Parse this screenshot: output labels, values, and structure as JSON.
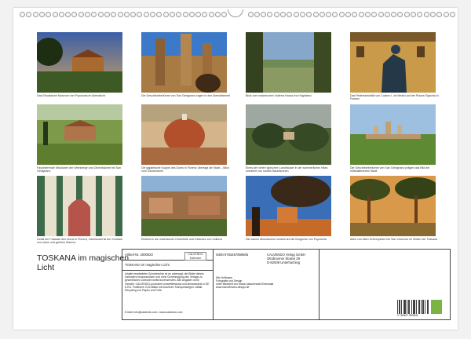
{
  "captions": [
    "Das Etruskische Museum von Populonia im Abendlicht",
    "Die Geschlechtertürme von San Gimignano ragen in den Abendhimmel",
    "Blick vom malerischen Volterra hinaus ins Hügelland",
    "Das Reiterstandbild von Cosimo I. de Medici auf der Piazza Signoria in Florenz",
    "Faszinierende Strukturen der Weinberge und Olivenbäume bei San Gimignano",
    "Die gigantische Kuppel des Doms in Florenz überragt die Stadt – Blick vom Glockenturm",
    "Eines der vielen typischen Landhäuser in der sommerlichen Hitze, umrahmt von runden Baumkronen",
    "Die Geschlechtertürme von San Gimignano prägen das Bild der mittelalterlichen Stadt",
    "Detail der Fassade des Doms in Florenz, interessant ist der Kontrast von rotem und grünem Marmor",
    "Einblick in die malerischen Hinterhöfe und Gärtchen von Volterra",
    "Die warme Abendsonne scheint auf die Burgruine von Populonia",
    "Allee von alten Schirmpinien bei San Vincenzo im Süden der Toskana"
  ],
  "title": "TOSKANA im magischen Licht",
  "imprint": {
    "artikel": "Artikel-Nr. 2000020",
    "logo": "CALVENDO Kalender",
    "title_line": "TOSKANA im magischen Licht",
    "isbn": "ISBN 9783457859605",
    "publisher": [
      "CALVENDO Verlag GmbH",
      "Ottobrunner Straße 39",
      "D-82008 Unterhaching"
    ],
    "author": [
      "Nils Hoffmann",
      "Fotografie und Design",
      "unter Mitarbeit von Maria Jakschewski Ebenwald",
      "www.nicnoffmann-design.de"
    ],
    "legal": "Inhalte bearbeiteter Schutzrechte ist es untersagt, die Bilder dieses Kalenders herauszulösen und ohne Genehmigung des Verlags zu gewerblichen Zwecken weiterzuverwenden. Alle Angaben ohne Gewähr. CALVENDO-produziert umweltbewusst und klimaneutral in DE & EU. Positivere CO2-Bilanz bei kürzeren Transportwegen. Abfall-Recycling von Papier und Folie.",
    "email": "E-Mail: info@calvendo.com • www.calvendo.com",
    "barcode_number": "9 783457 859605",
    "colors": {
      "green": "#7cb342",
      "border": "#444444"
    }
  }
}
